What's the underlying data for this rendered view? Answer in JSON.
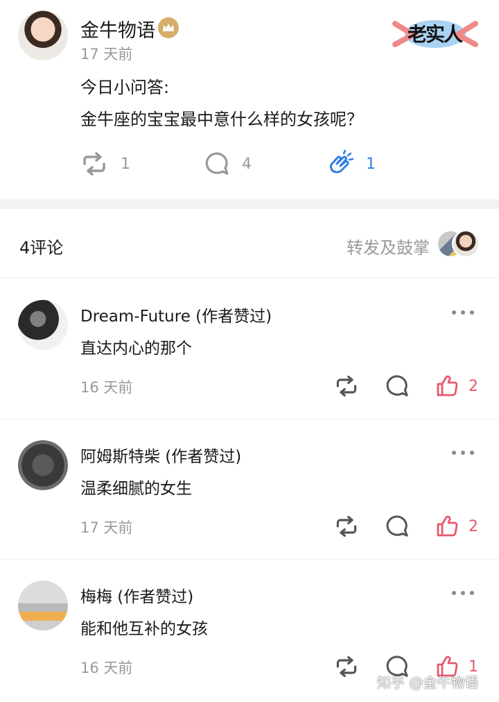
{
  "post": {
    "author": "金牛物语",
    "badge_icon": "crown-icon",
    "time": "17 天前",
    "sticker_text": "老实人",
    "line1": "今日小问答:",
    "line2": "金牛座的宝宝最中意什么样的女孩呢？",
    "actions": {
      "repost_count": "1",
      "comment_count": "4",
      "clap_count": "1"
    },
    "colors": {
      "accent": "#2f7ee0",
      "muted": "#999999",
      "like": "#e8586c",
      "badge": "#d6ad6b"
    }
  },
  "comments_header": {
    "count_label": "4评论",
    "reposts_label": "转发及鼓掌"
  },
  "comments": [
    {
      "name": "Dream-Future (作者赞过)",
      "text": "直达内心的那个",
      "time": "16 天前",
      "likes": "2"
    },
    {
      "name": "阿姆斯特柴 (作者赞过)",
      "text": "温柔细腻的女生",
      "time": "17 天前",
      "likes": "2"
    },
    {
      "name": "梅梅 (作者赞过)",
      "text": "能和他互补的女孩",
      "time": "16 天前",
      "likes": "1"
    }
  ],
  "watermark": "知乎 @金牛物语"
}
